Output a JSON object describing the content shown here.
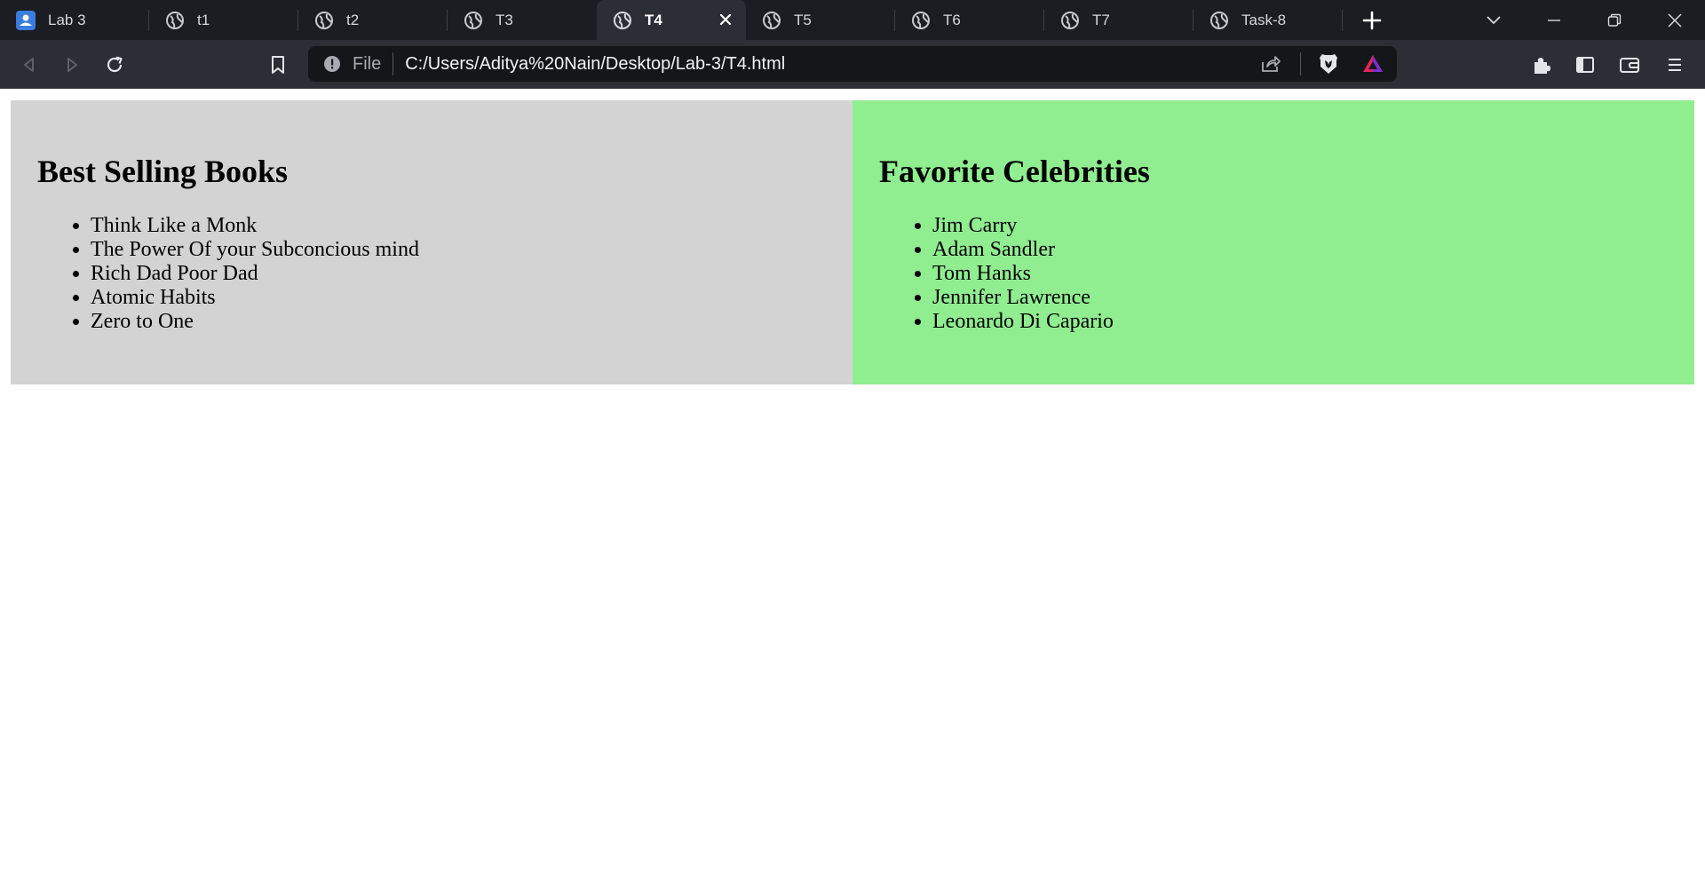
{
  "browser": {
    "tabs": [
      {
        "label": "Lab 3",
        "icon": "app-icon"
      },
      {
        "label": "t1",
        "icon": "globe-icon"
      },
      {
        "label": "t2",
        "icon": "globe-icon"
      },
      {
        "label": "T3",
        "icon": "globe-icon"
      },
      {
        "label": "T4",
        "icon": "globe-icon",
        "active": true
      },
      {
        "label": "T5",
        "icon": "globe-icon"
      },
      {
        "label": "T6",
        "icon": "globe-icon"
      },
      {
        "label": "T7",
        "icon": "globe-icon"
      },
      {
        "label": "Task-8",
        "icon": "globe-icon"
      }
    ],
    "address": {
      "scheme_label": "File",
      "url": "C:/Users/Aditya%20Nain/Desktop/Lab-3/T4.html"
    },
    "colors": {
      "tabstrip_bg": "#1c1d22",
      "toolbar_bg": "#2c2e36",
      "urlbar_bg": "#15161a"
    }
  },
  "page": {
    "left_panel": {
      "heading": "Best Selling Books",
      "items": [
        "Think Like a Monk",
        "The Power Of your Subconcious mind",
        "Rich Dad Poor Dad",
        "Atomic Habits",
        "Zero to One"
      ],
      "background": "#d3d3d3"
    },
    "right_panel": {
      "heading": "Favorite Celebrities",
      "items": [
        "Jim Carry",
        "Adam Sandler",
        "Tom Hanks",
        "Jennifer Lawrence",
        "Leonardo Di Capario"
      ],
      "background": "#90ee90"
    }
  }
}
